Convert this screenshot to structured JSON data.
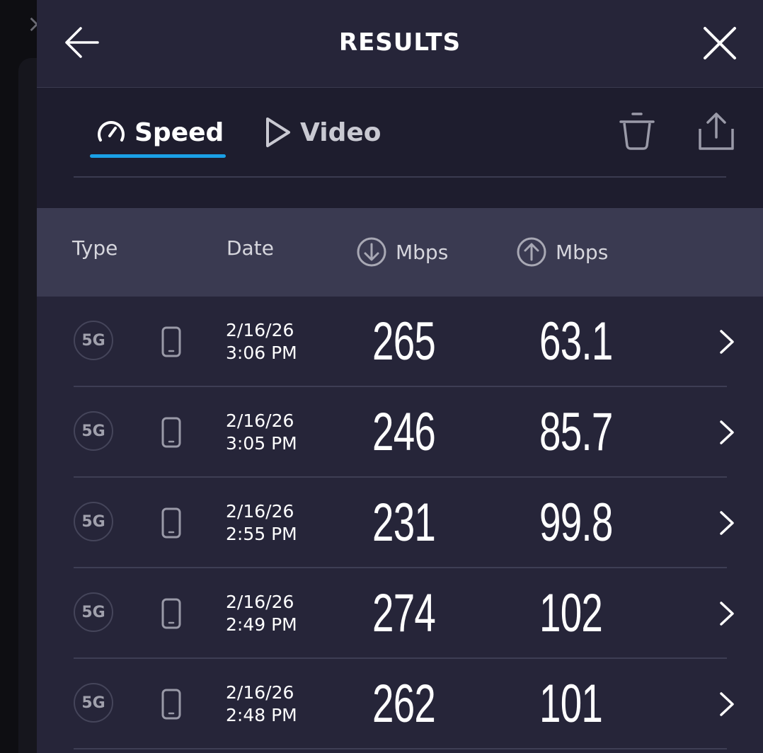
{
  "header": {
    "title": "RESULTS"
  },
  "tabs": [
    {
      "label": "Speed",
      "icon": "speedometer-icon",
      "active": true
    },
    {
      "label": "Video",
      "icon": "play-icon",
      "active": false
    }
  ],
  "toolbar": {
    "delete_icon": "trash-icon",
    "share_icon": "share-icon"
  },
  "columns": {
    "type": "Type",
    "date": "Date",
    "download": "Mbps",
    "upload": "Mbps"
  },
  "colors": {
    "background": "#262539",
    "tabs_background": "#1e1d2e",
    "column_header_background": "#3a3a51",
    "accent": "#1aa0e6"
  },
  "rows": [
    {
      "type": "5G",
      "date": "2/16/26",
      "time": "3:06 PM",
      "download": "265",
      "upload": "63.1"
    },
    {
      "type": "5G",
      "date": "2/16/26",
      "time": "3:05 PM",
      "download": "246",
      "upload": "85.7"
    },
    {
      "type": "5G",
      "date": "2/16/26",
      "time": "2:55 PM",
      "download": "231",
      "upload": "99.8"
    },
    {
      "type": "5G",
      "date": "2/16/26",
      "time": "2:49 PM",
      "download": "274",
      "upload": "102"
    },
    {
      "type": "5G",
      "date": "2/16/26",
      "time": "2:48 PM",
      "download": "262",
      "upload": "101"
    }
  ]
}
